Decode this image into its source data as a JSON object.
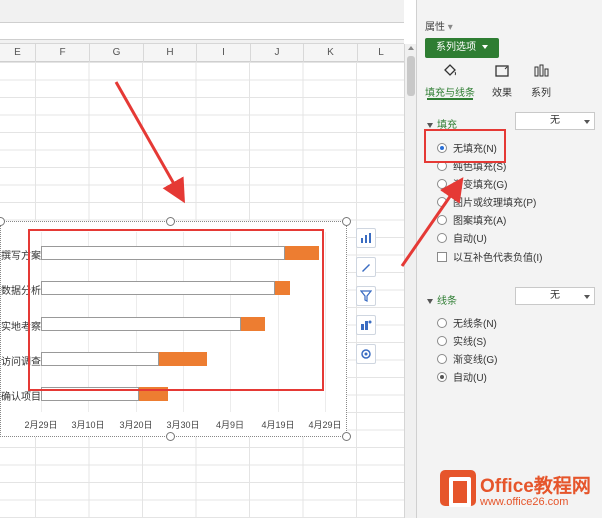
{
  "columns": [
    "E",
    "F",
    "G",
    "H",
    "I",
    "J",
    "K",
    "L"
  ],
  "chart_data": {
    "type": "bar",
    "categories": [
      "撰写方案",
      "数据分析",
      "实地考察",
      "访问调查",
      "确认项目"
    ],
    "series": [
      {
        "values": [
          "2020-04-20",
          "2020-04-18",
          "2020-04-11",
          "2020-03-25",
          "2020-03-21"
        ]
      },
      {
        "values": [
          7,
          3,
          5,
          10,
          6
        ]
      }
    ],
    "x_ticks": [
      "2月29日",
      "3月10日",
      "3月20日",
      "3月30日",
      "4月9日",
      "4月19日",
      "4月29日"
    ],
    "xlim": [
      "2020-02-24",
      "2020-05-03"
    ],
    "title": "",
    "colors": {
      "first_series_fill": "none",
      "second_series_fill": "#ed7d31"
    }
  },
  "tools": [
    "chart-elements-icon",
    "chart-style-icon",
    "chart-filter-icon",
    "chart-layout-icon",
    "chart-settings-icon"
  ],
  "pane": {
    "title": "属性",
    "tab": "系列选项",
    "subtabs": [
      "填充与线条",
      "效果",
      "系列"
    ],
    "fill_section": "填充",
    "fill_dropdown": "无",
    "fill_options": [
      "无填充(N)",
      "纯色填充(S)",
      "渐变填充(G)",
      "图片或纹理填充(P)",
      "图案填充(A)",
      "自动(U)"
    ],
    "fill_checkbox": "以互补色代表负值(I)",
    "line_section": "线条",
    "line_dropdown": "无",
    "line_options": [
      "无线条(N)",
      "实线(S)",
      "渐变线(G)",
      "自动(U)"
    ]
  },
  "watermark": {
    "brand": "Office教程网",
    "url": "www.office26.com"
  }
}
